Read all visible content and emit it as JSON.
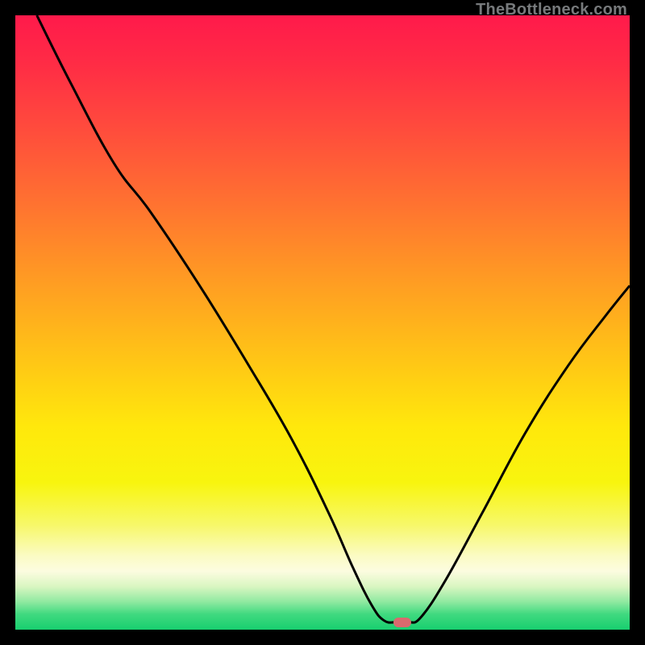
{
  "watermark": {
    "text": "TheBottleneck.com"
  },
  "colors": {
    "border": "#000000",
    "curve": "#000000",
    "marker": "#d96a6e",
    "gradient_stops": [
      {
        "offset": 0.0,
        "color": "#ff1a4b"
      },
      {
        "offset": 0.08,
        "color": "#ff2c45"
      },
      {
        "offset": 0.18,
        "color": "#ff4a3d"
      },
      {
        "offset": 0.3,
        "color": "#ff7031"
      },
      {
        "offset": 0.42,
        "color": "#ff9824"
      },
      {
        "offset": 0.55,
        "color": "#ffc217"
      },
      {
        "offset": 0.67,
        "color": "#ffe80c"
      },
      {
        "offset": 0.76,
        "color": "#f8f50e"
      },
      {
        "offset": 0.83,
        "color": "#f7f86a"
      },
      {
        "offset": 0.88,
        "color": "#fbfbc4"
      },
      {
        "offset": 0.905,
        "color": "#fcfce0"
      },
      {
        "offset": 0.93,
        "color": "#d9f6c1"
      },
      {
        "offset": 0.955,
        "color": "#8ee9a0"
      },
      {
        "offset": 0.975,
        "color": "#3fd97f"
      },
      {
        "offset": 1.0,
        "color": "#18cf6f"
      }
    ]
  },
  "chart_data": {
    "type": "line",
    "title": "",
    "xlabel": "",
    "ylabel": "",
    "xlim": [
      0,
      100
    ],
    "ylim": [
      0,
      100
    ],
    "series": [
      {
        "name": "bottleneck-curve",
        "points": [
          {
            "x": 3.5,
            "y": 100
          },
          {
            "x": 9,
            "y": 89
          },
          {
            "x": 16,
            "y": 76
          },
          {
            "x": 22,
            "y": 68
          },
          {
            "x": 30,
            "y": 56
          },
          {
            "x": 38,
            "y": 43
          },
          {
            "x": 45,
            "y": 31
          },
          {
            "x": 51,
            "y": 19
          },
          {
            "x": 55,
            "y": 10
          },
          {
            "x": 58,
            "y": 4
          },
          {
            "x": 60,
            "y": 1.5
          },
          {
            "x": 62,
            "y": 1.2
          },
          {
            "x": 64,
            "y": 1.2
          },
          {
            "x": 66,
            "y": 2
          },
          {
            "x": 70,
            "y": 8
          },
          {
            "x": 76,
            "y": 19
          },
          {
            "x": 83,
            "y": 32
          },
          {
            "x": 90,
            "y": 43
          },
          {
            "x": 96,
            "y": 51
          },
          {
            "x": 100,
            "y": 56
          }
        ]
      }
    ],
    "marker": {
      "x": 63,
      "y": 1.2
    }
  }
}
